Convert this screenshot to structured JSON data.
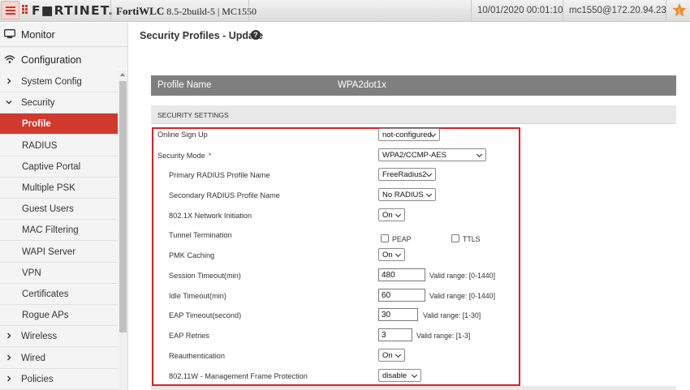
{
  "topbar": {
    "logo": "F■RTINET.",
    "product_name": "FortiWLC",
    "version": "8.5-2build-5 | MC1550",
    "datetime": "10/01/2020 00:01:10",
    "user": "mc1550@172.20.94.23",
    "alert_count": "1"
  },
  "sidebar": {
    "monitor": "Monitor",
    "configuration": "Configuration",
    "items": [
      {
        "label": "System Config",
        "kind": "group",
        "expanded": false
      },
      {
        "label": "Security",
        "kind": "group",
        "expanded": true
      },
      {
        "label": "Profile",
        "kind": "sub",
        "active": true
      },
      {
        "label": "RADIUS",
        "kind": "sub"
      },
      {
        "label": "Captive Portal",
        "kind": "sub"
      },
      {
        "label": "Multiple PSK",
        "kind": "sub"
      },
      {
        "label": "Guest Users",
        "kind": "sub"
      },
      {
        "label": "MAC Filtering",
        "kind": "sub"
      },
      {
        "label": "WAPI Server",
        "kind": "sub"
      },
      {
        "label": "VPN",
        "kind": "sub"
      },
      {
        "label": "Certificates",
        "kind": "sub"
      },
      {
        "label": "Rogue APs",
        "kind": "sub"
      },
      {
        "label": "Wireless",
        "kind": "group",
        "expanded": false
      },
      {
        "label": "Wired",
        "kind": "group",
        "expanded": false
      },
      {
        "label": "Policies",
        "kind": "group",
        "expanded": false
      }
    ]
  },
  "main": {
    "title": "Security Profiles - Update",
    "profile_name_label": "Profile Name",
    "profile_name_value": "WPA2dot1x",
    "section_title": "SECURITY SETTINGS",
    "fields": {
      "online_signup": {
        "label": "Online Sign Up",
        "value": "not-configured"
      },
      "security_mode": {
        "label": "Security Mode",
        "required_mark": "*",
        "value": "WPA2/CCMP-AES"
      },
      "primary_radius": {
        "label": "Primary RADIUS Profile Name",
        "value": "FreeRadius2"
      },
      "secondary_radius": {
        "label": "Secondary RADIUS Profile Name",
        "value": "No RADIUS"
      },
      "network_initiation": {
        "label": "802.1X Network Initiation",
        "value": "On"
      },
      "tunnel_termination": {
        "label": "Tunnel Termination",
        "peap": "PEAP",
        "ttls": "TTLS"
      },
      "pmk_caching": {
        "label": "PMK Caching",
        "value": "On"
      },
      "session_timeout": {
        "label": "Session Timeout(min)",
        "value": "480",
        "hint": "Valid range: [0-1440]"
      },
      "idle_timeout": {
        "label": "Idle Timeout(min)",
        "value": "60",
        "hint": "Valid range: [0-1440]"
      },
      "eap_timeout": {
        "label": "EAP Timeout(second)",
        "value": "30",
        "hint": "Valid range: [1-30]"
      },
      "eap_retries": {
        "label": "EAP Retries",
        "value": "3",
        "hint": "Valid range: [1-3]"
      },
      "reauthentication": {
        "label": "Reauthentication",
        "value": "On"
      },
      "mfp": {
        "label": "802.11W - Management Frame Protection",
        "value": "disable"
      }
    }
  },
  "colors": {
    "accent": "#d0392b",
    "highlight_border": "#d7202a",
    "profile_bar": "#7f7f7f"
  }
}
